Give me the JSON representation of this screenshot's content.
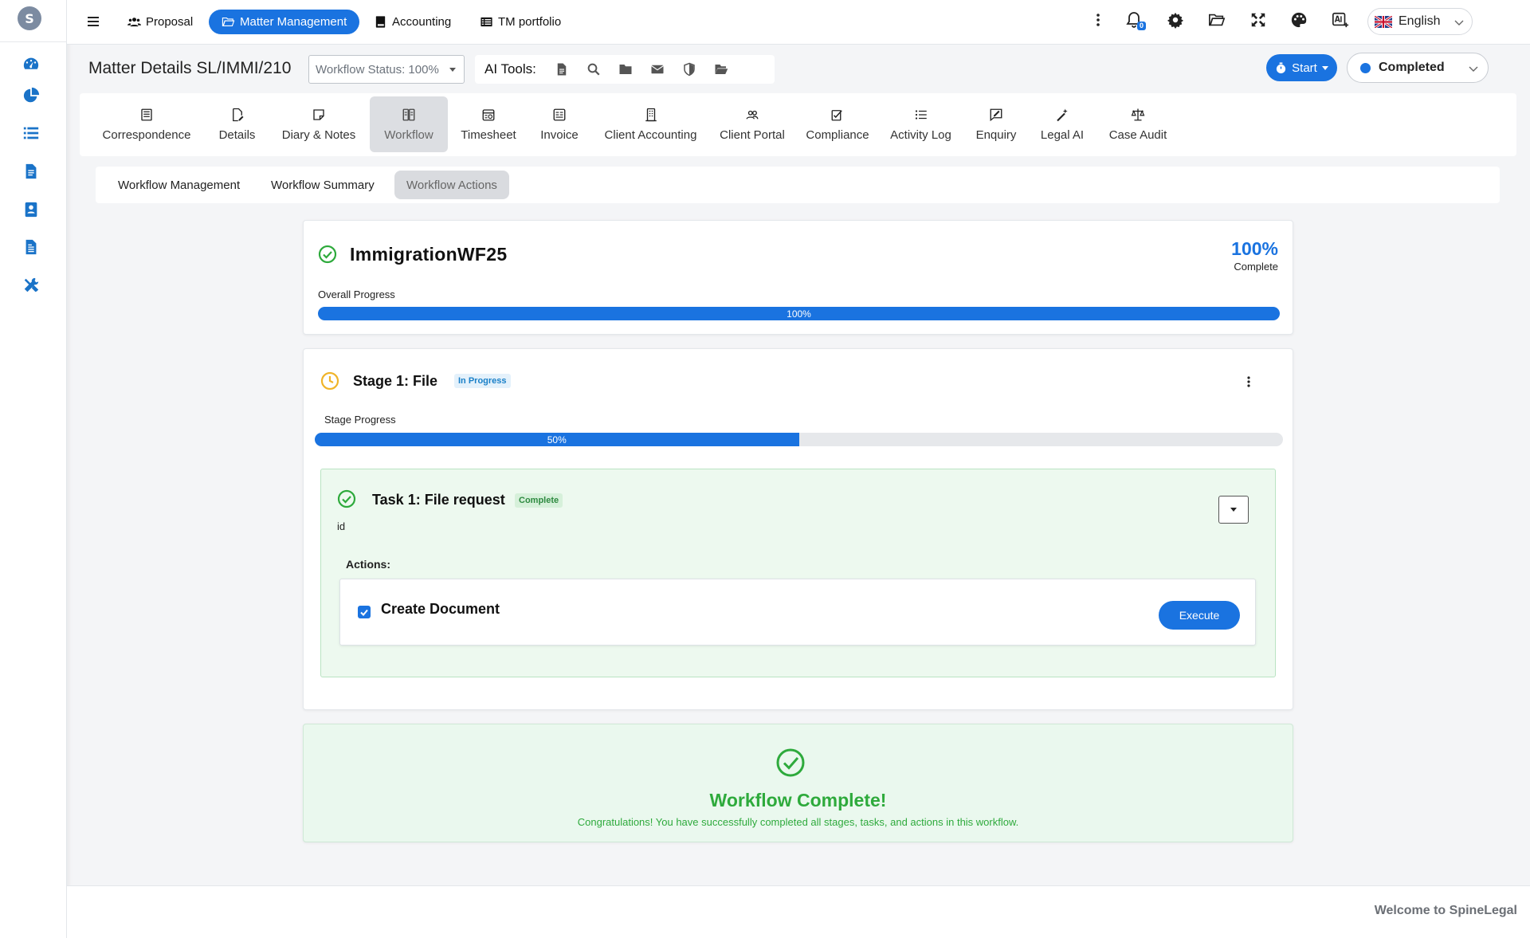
{
  "topnav": {
    "items": [
      {
        "label": "Proposal",
        "icon": "users-icon"
      },
      {
        "label": "Matter Management",
        "icon": "folder-open-icon",
        "active": true
      },
      {
        "label": "Accounting",
        "icon": "book-icon"
      },
      {
        "label": "TM portfolio",
        "icon": "list-icon"
      }
    ],
    "notification_count": "0",
    "language": "English"
  },
  "sidebar": {
    "logo_text": "S",
    "icons": [
      "dashboard-icon",
      "pie-chart-icon",
      "list-icon",
      "document-icon",
      "contact-icon",
      "file-text-icon",
      "tools-icon"
    ]
  },
  "matter": {
    "title": "Matter Details SL/IMMI/210",
    "workflow_status": "Workflow Status: 100%",
    "ai_tools_label": "AI Tools:",
    "start_label": "Start",
    "status_value": "Completed"
  },
  "main_tabs": [
    {
      "label": "Correspondence"
    },
    {
      "label": "Details"
    },
    {
      "label": "Diary & Notes"
    },
    {
      "label": "Workflow",
      "active": true
    },
    {
      "label": "Timesheet"
    },
    {
      "label": "Invoice"
    },
    {
      "label": "Client Accounting"
    },
    {
      "label": "Client Portal"
    },
    {
      "label": "Compliance"
    },
    {
      "label": "Activity Log"
    },
    {
      "label": "Enquiry"
    },
    {
      "label": "Legal AI"
    },
    {
      "label": "Case Audit"
    }
  ],
  "sub_tabs": [
    {
      "label": "Workflow Management"
    },
    {
      "label": "Workflow Summary"
    },
    {
      "label": "Workflow Actions",
      "active": true
    }
  ],
  "workflow": {
    "name": "ImmigrationWF25",
    "percent_label": "100%",
    "percent_sub": "Complete",
    "progress_label": "Overall Progress",
    "progress": 1.0,
    "progress_text": "100%"
  },
  "stage": {
    "title": "Stage 1: File",
    "status": "In Progress",
    "progress_label": "Stage Progress",
    "progress": 0.5,
    "progress_text": "50%",
    "task": {
      "title": "Task 1: File request",
      "status": "Complete",
      "description": "id",
      "actions_label": "Actions:",
      "action_name": "Create Document",
      "action_checked": true,
      "execute_label": "Execute"
    }
  },
  "completion": {
    "title": "Workflow Complete!",
    "message": "Congratulations! You have successfully completed all stages, tasks, and actions in this workflow."
  },
  "footer": {
    "text": "Welcome to SpineLegal"
  },
  "colors": {
    "primary": "#1a73e0",
    "success": "#2eaa3c",
    "warning": "#f0b429",
    "sidebar_icon": "#1a73c8"
  }
}
